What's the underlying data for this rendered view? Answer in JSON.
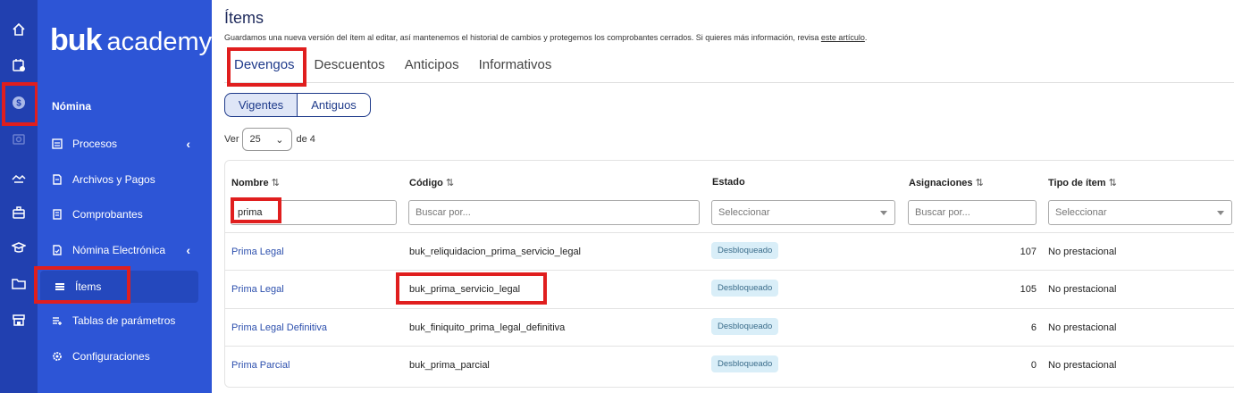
{
  "rail": {
    "icons": [
      "home-icon",
      "calendar-icon",
      "money-icon",
      "camera-icon",
      "handshake-icon",
      "briefcase-icon",
      "graduation-cap-icon",
      "folder-icon",
      "store-icon"
    ]
  },
  "sidebar": {
    "logo_brand": "buk",
    "logo_product": "academy",
    "section_title": "Nómina",
    "items": [
      {
        "label": "Procesos",
        "icon": "calculator-icon",
        "chevron": "‹"
      },
      {
        "label": "Archivos y Pagos",
        "icon": "file-icon"
      },
      {
        "label": "Comprobantes",
        "icon": "receipt-icon"
      },
      {
        "label": "Nómina Electrónica",
        "icon": "document-check-icon",
        "chevron": "‹"
      },
      {
        "label": "Ítems",
        "icon": "list-icon"
      },
      {
        "label": "Tablas de parámetros",
        "icon": "list-add-icon"
      },
      {
        "label": "Configuraciones",
        "icon": "gear-icon"
      }
    ]
  },
  "page": {
    "title": "Ítems",
    "description": "Guardamos una nueva versión del ítem al editar, así mantenemos el historial de cambios y protegemos los comprobantes cerrados. Si quieres más información, revisa",
    "link_text": "este artículo",
    "description_end": "."
  },
  "tabs": [
    "Devengos",
    "Descuentos",
    "Anticipos",
    "Informativos"
  ],
  "segments": [
    "Vigentes",
    "Antiguos"
  ],
  "pager": {
    "prefix": "Ver",
    "per_page": "25",
    "suffix": "de 4"
  },
  "table": {
    "headers": {
      "nombre": "Nombre",
      "codigo": "Código",
      "estado": "Estado",
      "asignaciones": "Asignaciones",
      "tipo": "Tipo de ítem"
    },
    "sort_glyph": "⇅",
    "filters": {
      "nombre_value": "prima",
      "codigo_placeholder": "Buscar por...",
      "estado_placeholder": "Seleccionar",
      "asignaciones_placeholder": "Buscar por...",
      "tipo_placeholder": "Seleccionar"
    },
    "rows": [
      {
        "nombre": "Prima Legal",
        "codigo": "buk_reliquidacion_prima_servicio_legal",
        "estado": "Desbloqueado",
        "asignaciones": "107",
        "tipo": "No prestacional"
      },
      {
        "nombre": "Prima Legal",
        "codigo": "buk_prima_servicio_legal",
        "estado": "Desbloqueado",
        "asignaciones": "105",
        "tipo": "No prestacional"
      },
      {
        "nombre": "Prima Legal Definitiva",
        "codigo": "buk_finiquito_prima_legal_definitiva",
        "estado": "Desbloqueado",
        "asignaciones": "6",
        "tipo": "No prestacional"
      },
      {
        "nombre": "Prima Parcial",
        "codigo": "buk_prima_parcial",
        "estado": "Desbloqueado",
        "asignaciones": "0",
        "tipo": "No prestacional"
      }
    ]
  },
  "colors": {
    "rail": "#2140b0",
    "sidebar": "#2d55d6",
    "highlight": "#e01e1e",
    "link": "#2c4fad",
    "badge_bg": "#d9eef8"
  }
}
